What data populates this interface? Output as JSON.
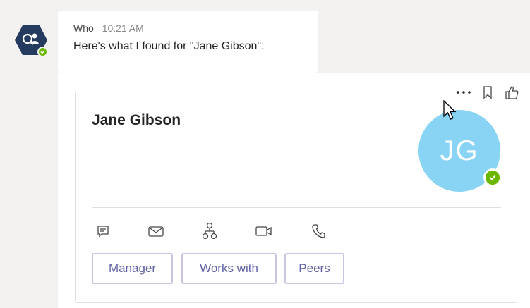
{
  "message": {
    "sender": "Who",
    "time": "10:21 AM",
    "text": "Here's what I found for \"Jane Gibson\":"
  },
  "card": {
    "name": "Jane Gibson",
    "initials": "JG",
    "avatar_color": "#89d4f4",
    "status_color": "#6bb700",
    "action_icons": [
      "chat-icon",
      "mail-icon",
      "org-chart-icon",
      "video-call-icon",
      "phone-icon"
    ],
    "buttons": {
      "manager": "Manager",
      "works_with": "Works with",
      "peers": "Peers"
    }
  },
  "hover_actions": [
    "more-options-icon",
    "bookmark-icon",
    "like-icon"
  ],
  "colors": {
    "background": "#f3f2f1",
    "brand": "#6264a7",
    "bot_avatar": "#243a5e"
  }
}
